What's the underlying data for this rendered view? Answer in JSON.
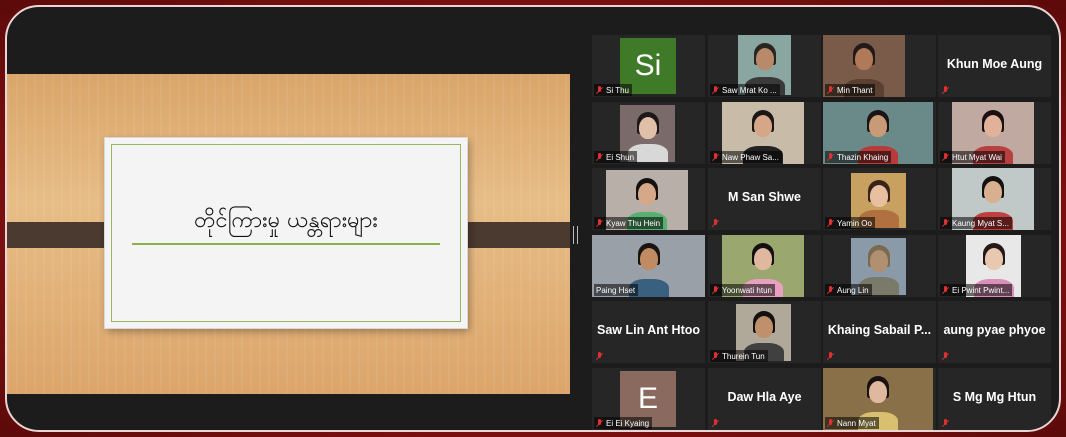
{
  "slide": {
    "title": "တိုင်ကြားမှု ယန္တရားများ"
  },
  "participants": [
    {
      "name": "Si Thu",
      "display": "avatar",
      "initials": "Si",
      "avatar_color": "#3f7a28"
    },
    {
      "name": "Saw Mrat Ko ...",
      "display": "video"
    },
    {
      "name": "Min Thant",
      "display": "video"
    },
    {
      "name": "Khun Moe Aung",
      "display": "name"
    },
    {
      "name": "Ei Shun",
      "display": "video"
    },
    {
      "name": "Naw Phaw Sa...",
      "display": "video"
    },
    {
      "name": "Thazin Khaing",
      "display": "video"
    },
    {
      "name": "Htut Myat Wai",
      "display": "video"
    },
    {
      "name": "Kyaw Thu Hein",
      "display": "video"
    },
    {
      "name": "M San Shwe",
      "display": "name"
    },
    {
      "name": "Yamin Oo",
      "display": "video"
    },
    {
      "name": "Kaung Myat S...",
      "display": "video"
    },
    {
      "name": "Paing Hset",
      "display": "video",
      "active_speaker": true
    },
    {
      "name": "Yoonwati htun",
      "display": "video"
    },
    {
      "name": "Aung Lin",
      "display": "video"
    },
    {
      "name": "Ei Pwint Pwint...",
      "display": "video"
    },
    {
      "name": "Saw Lin Ant Htoo",
      "display": "name"
    },
    {
      "name": "Thurein Tun",
      "display": "video"
    },
    {
      "name": "Khaing  Sabail P...",
      "display": "name"
    },
    {
      "name": "aung pyae phyoe",
      "display": "name"
    },
    {
      "name": "Ei Ei Kyaing",
      "display": "avatar",
      "initials": "E",
      "avatar_color": "#8a6a5e"
    },
    {
      "name": "Daw  Hla Aye",
      "display": "name"
    },
    {
      "name": "Nann Myat",
      "display": "video"
    },
    {
      "name": "S Mg Mg Htun",
      "display": "name"
    }
  ],
  "colors": {
    "frame": "#7a0f0f",
    "active_outline": "#e6e63a",
    "muted_icon": "#e03030"
  }
}
